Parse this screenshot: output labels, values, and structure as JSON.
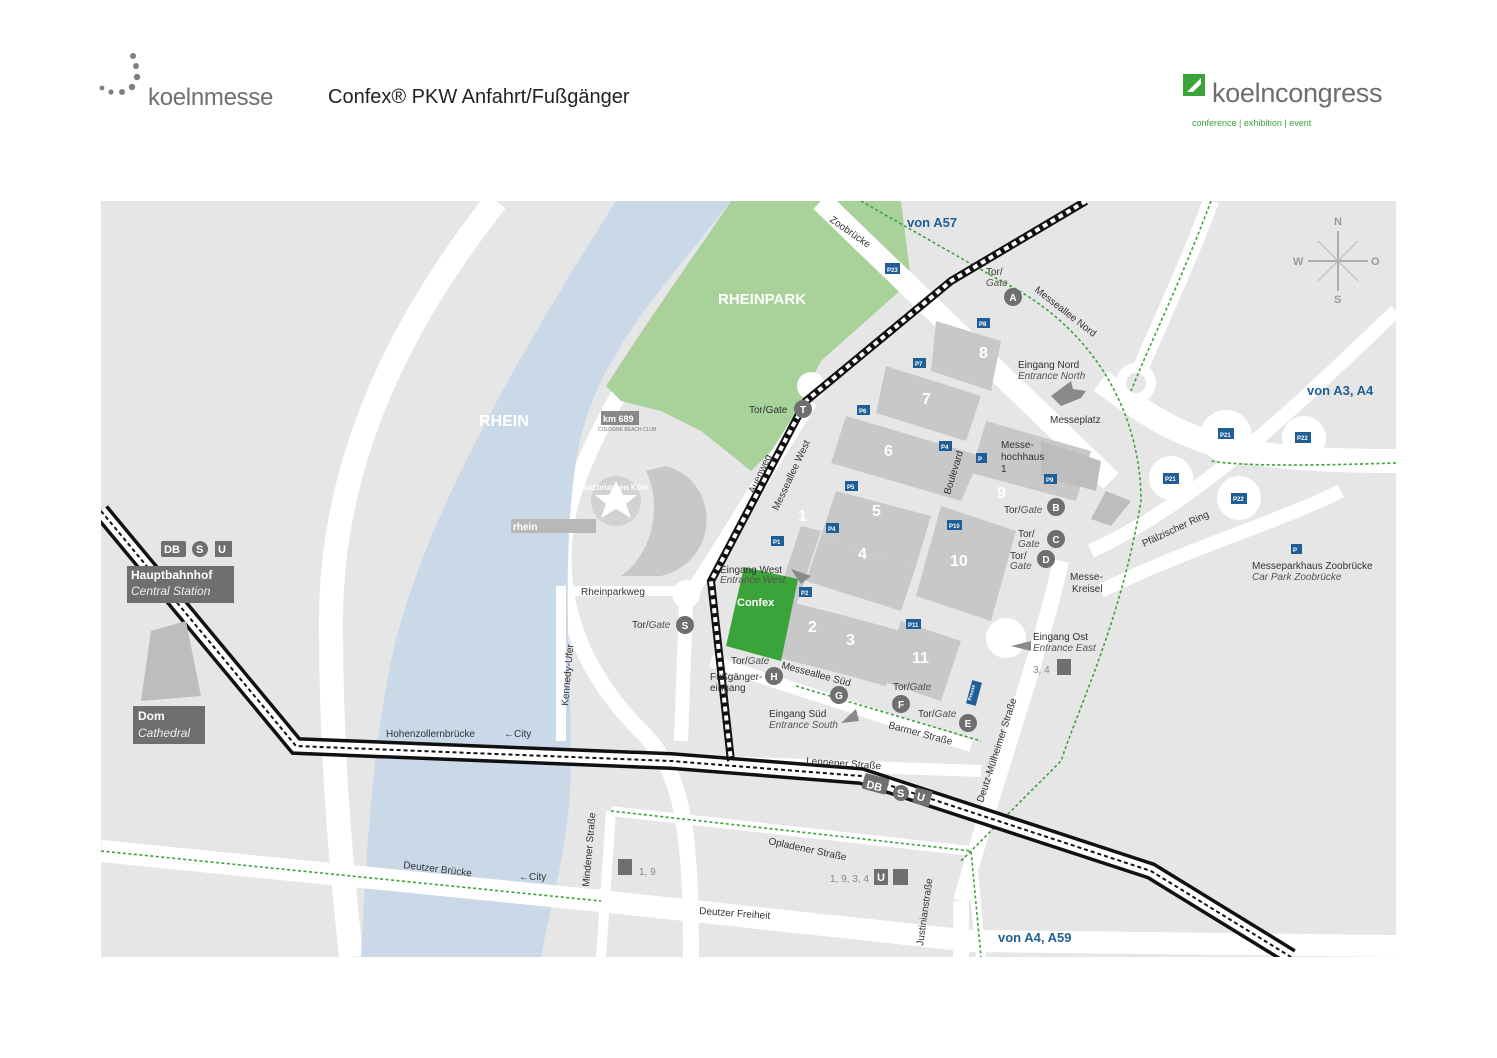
{
  "header": {
    "koelnmesse_logo": "koelnmesse",
    "title": "Confex® PKW Anfahrt/Fußgänger",
    "koelncongress_logo": "koelncongress",
    "koelncongress_tagline": "conference | exhibition | event"
  },
  "colors": {
    "background": "#e6e6e6",
    "road": "#ffffff",
    "river": "#c9d9e8",
    "park": "#a9d29a",
    "hall": "#c8c8c8",
    "confex": "#3aa43a",
    "accent_blue": "#1f5f95",
    "walk_path": "#3aa43a"
  },
  "map": {
    "water": {
      "rhein": "RHEIN"
    },
    "parks": {
      "rheinpark": "RHEINPARK"
    },
    "compass": {
      "n": "N",
      "s": "S",
      "w": "W",
      "o": "O"
    },
    "highways": {
      "a57": "von A57",
      "a3_a4": "von A3, A4",
      "a4_a59": "von A4, A59"
    },
    "halls": [
      "1",
      "2",
      "3",
      "4",
      "5",
      "6",
      "7",
      "8",
      "9",
      "10",
      "11"
    ],
    "confex": "Confex",
    "streets": {
      "zoobruecke": "Zoobrücke",
      "messeallee_nord": "Messeallee Nord",
      "auenweg": "Auenweg",
      "messeallee_west": "Messeallee West",
      "boulevard": "Boulevard",
      "rheinparkweg": "Rheinparkweg",
      "kennedy_ufer": "Kennedy-Ufer",
      "hohenzollernbruecke": "Hohenzollernbrücke",
      "messeallee_sued": "Messeallee Süd",
      "barmer_strasse": "Barmer Straße",
      "lenneper_strasse": "Lenneper Straße",
      "deutz_muelheimer": "Deutz-Mülheimer Straße",
      "pfaelzischer_ring": "Pfälzischer Ring",
      "mindener_strasse": "Mindener Straße",
      "opladener_strasse": "Opladener Straße",
      "deutzer_bruecke": "Deutzer Brücke",
      "deutzer_freiheit": "Deutzer Freiheit",
      "justinianstrasse": "Justinianstraße"
    },
    "places": {
      "messeplatz": "Messeplatz",
      "messehochhaus_1": "Messe-",
      "messehochhaus_2": "hochhaus",
      "messehochhaus_3": "1",
      "messekreisel_1": "Messe-",
      "messekreisel_2": "Kreisel",
      "tanzbrunnen": "Tanzbrunnen Köln",
      "km689": "km 689",
      "km689_sub": "COLOGNE BEACH CLUB",
      "rhein_sign": "rhein",
      "parkhaus_1": "Messeparkhaus Zoobrücke",
      "parkhaus_2": "Car Park Zoobrücke"
    },
    "entrances": {
      "nord_1": "Eingang Nord",
      "nord_2": "Entrance North",
      "west_1": "Eingang West",
      "west_2": "Entrance West",
      "ost_1": "Eingang Ost",
      "ost_2": "Entrance East",
      "sued_1": "Eingang Süd",
      "sued_2": "Entrance South",
      "fuss_1": "Fußgänger-",
      "fuss_2": "eingang"
    },
    "gate_word": "Tor/",
    "gate_word_en": "Gate",
    "gate_full": "Tor/Gate",
    "gates": [
      "A",
      "B",
      "C",
      "D",
      "E",
      "F",
      "G",
      "H",
      "S",
      "T"
    ],
    "parking": {
      "p1": "P1",
      "p2": "P2",
      "p4": "P4",
      "p5": "P5",
      "p6": "P6",
      "p7": "P7",
      "p8": "P8",
      "p9": "P9",
      "p10": "P10",
      "p11": "P11",
      "p21a": "P21",
      "p21b": "P21",
      "p22a": "P22",
      "p22b": "P22",
      "p23": "P23",
      "p": "P",
      "p_press": "Presse"
    },
    "stations": {
      "hbf_1": "Hauptbahnhof",
      "hbf_2": "Central Station",
      "dom_1": "Dom",
      "dom_2": "Cathedral",
      "db": "DB",
      "s": "S",
      "u": "U",
      "city": "City",
      "lines_east": "3, 4",
      "lines_deutz": "1, 9",
      "lines_bf": "1, 9, 3, 4"
    }
  }
}
